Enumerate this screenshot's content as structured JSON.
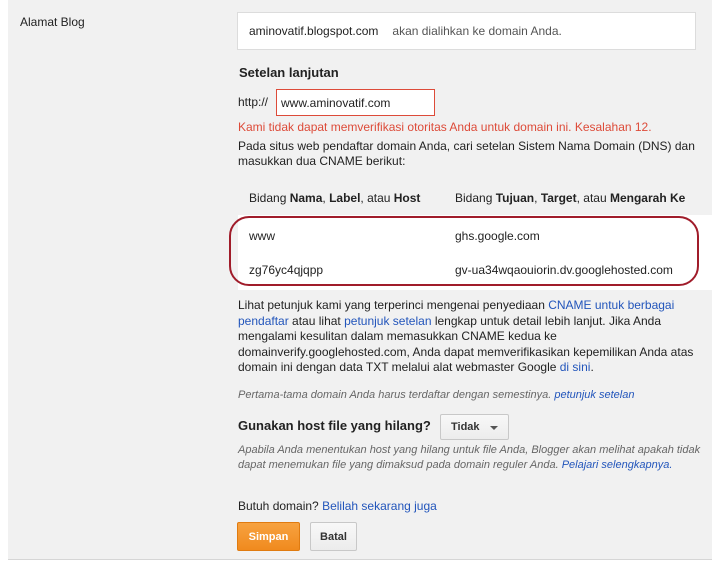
{
  "row_label": "Alamat Blog",
  "domain_box": {
    "domain": "aminovatif.blogspot.com",
    "note": "akan dialihkan ke domain Anda."
  },
  "advanced": {
    "title": "Setelan lanjutan",
    "http_prefix": "http://",
    "url_value": "www.aminovatif.com",
    "error": "Kami tidak dapat memverifikasi otoritas Anda untuk domain ini. Kesalahan 12.",
    "instructions": "Pada situs web pendaftar domain Anda, cari setelan Sistem Nama Domain (DNS) dan masukkan dua CNAME berikut:"
  },
  "cname": {
    "header_name_prefix": "Bidang ",
    "header_name_b1": "Nama",
    "header_name_sep1": ", ",
    "header_name_b2": "Label",
    "header_name_sep2": ", atau ",
    "header_name_b3": "Host",
    "header_target_prefix": "Bidang ",
    "header_target_b1": "Tujuan",
    "header_target_sep1": ", ",
    "header_target_b2": "Target",
    "header_target_sep2": ", atau ",
    "header_target_b3": "Mengarah Ke",
    "rows": [
      {
        "name": "www",
        "target": "ghs.google.com"
      },
      {
        "name": "zg76yc4qjqpp",
        "target": "gv-ua34wqaouiorin.dv.googlehosted.com"
      }
    ]
  },
  "help": {
    "p1": "Lihat petunjuk kami yang terperinci mengenai penyediaan ",
    "link_cname": "CNAME untuk berbagai pendaftar",
    "p2": " atau lihat ",
    "link_settings": "petunjuk setelan",
    "p3": " lengkap untuk detail lebih lanjut. Jika Anda mengalami kesulitan dalam memasukkan CNAME kedua ke domainverify.googlehosted.com, Anda dapat memverifikasikan kepemilikan Anda atas domain ini dengan data TXT melalui alat webmaster Google ",
    "link_here": "di sini",
    "p4": "."
  },
  "note": {
    "text": "Pertama-tama domain Anda harus terdaftar dengan semestinya. ",
    "link": "petunjuk setelan"
  },
  "missing_host": {
    "label": "Gunakan host file yang hilang?",
    "selected": "Tidak",
    "desc": "Apabila Anda menentukan host yang hilang untuk file Anda, Blogger akan melihat apakah tidak dapat menemukan file yang dimaksud pada domain reguler Anda. ",
    "learn_more": "Pelajari selengkapnya."
  },
  "buy": {
    "text": "Butuh domain? ",
    "link": "Belilah sekarang juga"
  },
  "buttons": {
    "save": "Simpan",
    "cancel": "Batal"
  },
  "colors": {
    "error": "#dd4b39",
    "link": "#2255bb",
    "save_button": "#f08a1e",
    "highlight_ring": "#a01c2a"
  }
}
